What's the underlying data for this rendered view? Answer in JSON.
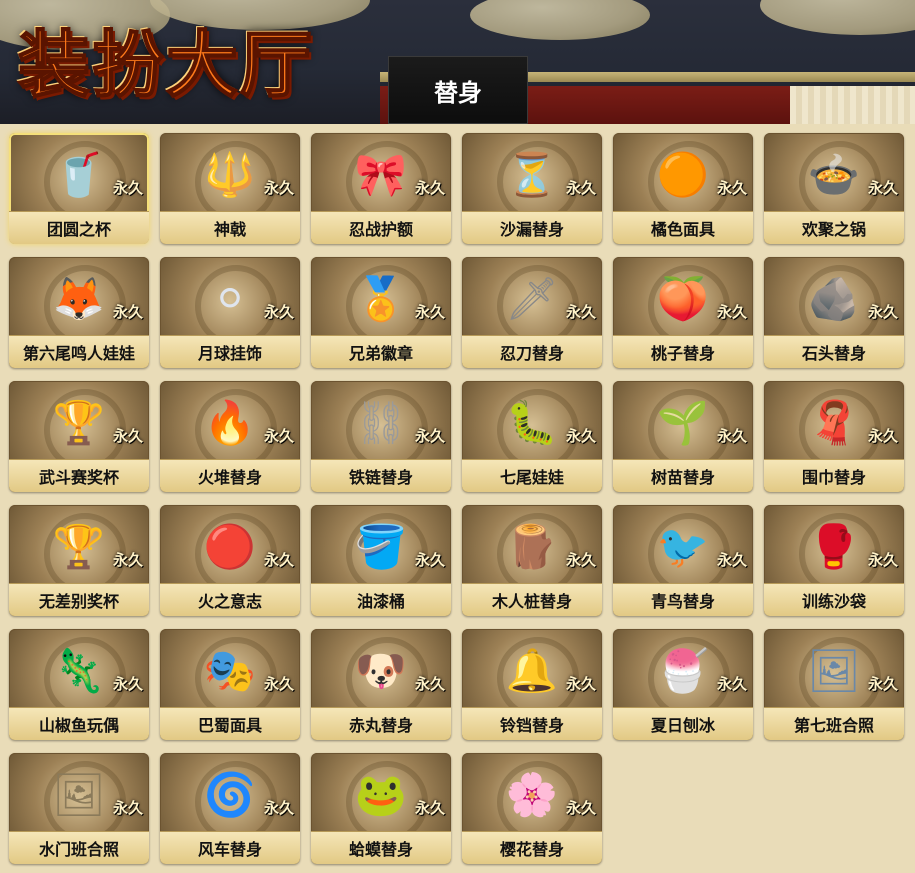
{
  "header": {
    "title": "装扮大厅",
    "tab_label": "替身"
  },
  "colors": {
    "title": "#ff7a1a",
    "card_label_bg": "#eed9a0",
    "badge_text": "#fff2c8"
  },
  "items": [
    {
      "name": "团圆之杯",
      "badge": "永久",
      "icon": "cup-icon",
      "glyph": "🥤",
      "color": "#e0602a",
      "selected": true
    },
    {
      "name": "神戟",
      "badge": "永久",
      "icon": "halberd-icon",
      "glyph": "🔱",
      "color": "#333333",
      "selected": false
    },
    {
      "name": "忍战护额",
      "badge": "永久",
      "icon": "headband-icon",
      "glyph": "🎀",
      "color": "#222222",
      "selected": false
    },
    {
      "name": "沙漏替身",
      "badge": "永久",
      "icon": "hourglass-icon",
      "glyph": "⏳",
      "color": "#b9773e",
      "selected": false
    },
    {
      "name": "橘色面具",
      "badge": "永久",
      "icon": "mask-icon",
      "glyph": "🟠",
      "color": "#d05a1c",
      "selected": false
    },
    {
      "name": "欢聚之锅",
      "badge": "永久",
      "icon": "pot-icon",
      "glyph": "🍲",
      "color": "#c7705a",
      "selected": false
    },
    {
      "name": "第六尾鸣人娃娃",
      "badge": "永久",
      "icon": "fox-doll-icon",
      "glyph": "🦊",
      "color": "#b33b1a",
      "selected": false
    },
    {
      "name": "月球挂饰",
      "badge": "永久",
      "icon": "moon-charm-icon",
      "glyph": "⚪",
      "color": "#dfe5ee",
      "selected": false
    },
    {
      "name": "兄弟徽章",
      "badge": "永久",
      "icon": "badge-icon",
      "glyph": "🏅",
      "color": "#c2612e",
      "selected": false
    },
    {
      "name": "忍刀替身",
      "badge": "永久",
      "icon": "sword-icon",
      "glyph": "🗡",
      "color": "#888888",
      "selected": false
    },
    {
      "name": "桃子替身",
      "badge": "永久",
      "icon": "peach-icon",
      "glyph": "🍑",
      "color": "#f0a0a0",
      "selected": false
    },
    {
      "name": "石头替身",
      "badge": "永久",
      "icon": "stone-icon",
      "glyph": "🪨",
      "color": "#a9b2b8",
      "selected": false
    },
    {
      "name": "武斗赛奖杯",
      "badge": "永久",
      "icon": "trophy-icon",
      "glyph": "🏆",
      "color": "#777777",
      "selected": false
    },
    {
      "name": "火堆替身",
      "badge": "永久",
      "icon": "campfire-icon",
      "glyph": "🔥",
      "color": "#ef7b1f",
      "selected": false
    },
    {
      "name": "铁链替身",
      "badge": "永久",
      "icon": "chain-icon",
      "glyph": "⛓",
      "color": "#9a9a9a",
      "selected": false
    },
    {
      "name": "七尾娃娃",
      "badge": "永久",
      "icon": "larva-doll-icon",
      "glyph": "🐛",
      "color": "#3c9b4b",
      "selected": false
    },
    {
      "name": "树苗替身",
      "badge": "永久",
      "icon": "sapling-icon",
      "glyph": "🌱",
      "color": "#5ea33b",
      "selected": false
    },
    {
      "name": "围巾替身",
      "badge": "永久",
      "icon": "scarf-icon",
      "glyph": "🧣",
      "color": "#4aa04a",
      "selected": false
    },
    {
      "name": "无差别奖杯",
      "badge": "永久",
      "icon": "claw-trophy-icon",
      "glyph": "🏆",
      "color": "#8c8c8c",
      "selected": false
    },
    {
      "name": "火之意志",
      "badge": "永久",
      "icon": "fire-will-icon",
      "glyph": "🔴",
      "color": "#c43a1c",
      "selected": false
    },
    {
      "name": "油漆桶",
      "badge": "永久",
      "icon": "paint-bucket-icon",
      "glyph": "🪣",
      "color": "#6ab0d8",
      "selected": false
    },
    {
      "name": "木人桩替身",
      "badge": "永久",
      "icon": "wooden-dummy-icon",
      "glyph": "🪵",
      "color": "#8a4a2a",
      "selected": false
    },
    {
      "name": "青鸟替身",
      "badge": "永久",
      "icon": "bluebird-icon",
      "glyph": "🐦",
      "color": "#2d9ad6",
      "selected": false
    },
    {
      "name": "训练沙袋",
      "badge": "永久",
      "icon": "punching-bag-icon",
      "glyph": "🥊",
      "color": "#b01c1c",
      "selected": false
    },
    {
      "name": "山椒鱼玩偶",
      "badge": "永久",
      "icon": "salamander-doll-icon",
      "glyph": "🦎",
      "color": "#7a6a6a",
      "selected": false
    },
    {
      "name": "巴蜀面具",
      "badge": "永久",
      "icon": "opera-mask-icon",
      "glyph": "🎭",
      "color": "#c8322a",
      "selected": false
    },
    {
      "name": "赤丸替身",
      "badge": "永久",
      "icon": "puppy-icon",
      "glyph": "🐶",
      "color": "#f0d2d2",
      "selected": false
    },
    {
      "name": "铃铛替身",
      "badge": "永久",
      "icon": "bell-icon",
      "glyph": "🔔",
      "color": "#b0b0b0",
      "selected": false
    },
    {
      "name": "夏日刨冰",
      "badge": "永久",
      "icon": "shaved-ice-icon",
      "glyph": "🍧",
      "color": "#e86a8a",
      "selected": false
    },
    {
      "name": "第七班合照",
      "badge": "永久",
      "icon": "photo-frame-icon",
      "glyph": "🖼",
      "color": "#6a88a8",
      "selected": false
    },
    {
      "name": "水门班合照",
      "badge": "永久",
      "icon": "photo-frame-icon",
      "glyph": "🖼",
      "color": "#8a7a5a",
      "selected": false
    },
    {
      "name": "风车替身",
      "badge": "永久",
      "icon": "pinwheel-icon",
      "glyph": "🌀",
      "color": "#e0602a",
      "selected": false
    },
    {
      "name": "蛤蟆替身",
      "badge": "永久",
      "icon": "toad-icon",
      "glyph": "🐸",
      "color": "#c8767a",
      "selected": false
    },
    {
      "name": "樱花替身",
      "badge": "永久",
      "icon": "sakura-icon",
      "glyph": "🌸",
      "color": "#e78aa8",
      "selected": false
    }
  ]
}
